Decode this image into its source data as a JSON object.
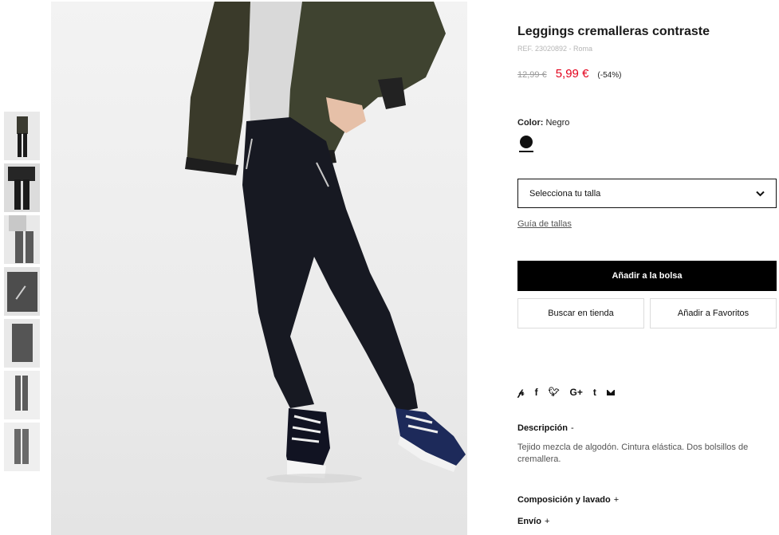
{
  "product": {
    "title": "Leggings cremalleras contraste",
    "ref": "REF. 23020892 - Roma",
    "old_price": "12,99 €",
    "new_price": "5,99 €",
    "discount": "(-54%)"
  },
  "color": {
    "label": "Color:",
    "value": "Negro",
    "swatch_color": "#111111"
  },
  "size": {
    "placeholder": "Selecciona tu talla",
    "guide_link": "Guía de tallas"
  },
  "actions": {
    "add_to_bag": "Añadir a la bolsa",
    "find_in_store": "Buscar en tienda",
    "add_to_favorites": "Añadir a Favoritos"
  },
  "share": {
    "icons": [
      "pinterest-icon",
      "facebook-icon",
      "twitter-icon",
      "google-plus-icon",
      "tumblr-icon",
      "email-icon"
    ],
    "glyphs": [
      "P",
      "f",
      "✓",
      "G+",
      "t",
      ""
    ]
  },
  "sections": {
    "description": {
      "label": "Descripción",
      "sign": "-",
      "text": "Tejido mezcla de algodón. Cintura elástica. Dos bolsillos de cremallera."
    },
    "composition": {
      "label": "Composición y lavado",
      "sign": "+"
    },
    "shipping": {
      "label": "Envío",
      "sign": "+"
    }
  },
  "gallery": {
    "thumbnail_count": 7,
    "selected_thumbnail": 1
  },
  "colors": {
    "price_accent": "#e3001b",
    "primary_button": "#000000"
  }
}
